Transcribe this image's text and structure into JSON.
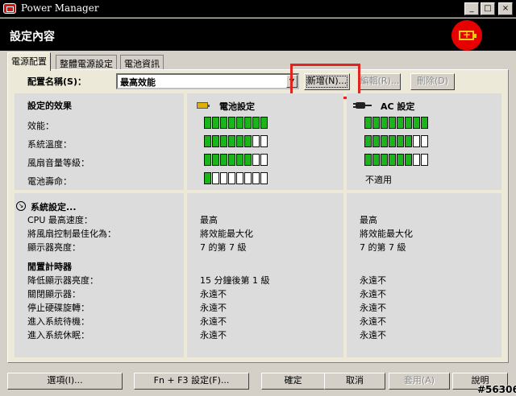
{
  "window": {
    "title": "Power Manager",
    "min": "_",
    "max": "□",
    "close": "×"
  },
  "header": {
    "title": "設定內容"
  },
  "tabs": [
    "電源配置",
    "整體電源設定",
    "電池資訊"
  ],
  "profile": {
    "label": "配置名稱(S)：",
    "selected": "最高效能",
    "new_label": "新增(N)...",
    "edit_label": "編輯(R)...",
    "delete_label": "刪除(D)"
  },
  "effects": {
    "title": "設定的效果",
    "rows": [
      "效能：",
      "系統溫度：",
      "風扇音量等級：",
      "電池壽命："
    ],
    "battery_header": "電池設定",
    "ac_header": "AC 設定",
    "battery_levels": [
      8,
      6,
      6,
      1
    ],
    "ac_levels": [
      8,
      6,
      6,
      null
    ],
    "meter_max": 8,
    "not_applicable": "不適用",
    "on_color": "#1bb51b"
  },
  "system": {
    "title": "系統設定...",
    "rows": [
      {
        "label": "CPU 最高速度：",
        "battery": "最高",
        "ac": "最高"
      },
      {
        "label": "將風扇控制最佳化為：",
        "battery": "將效能最大化",
        "ac": "將效能最大化"
      },
      {
        "label": "顯示器亮度：",
        "battery": "7 的第 7 級",
        "ac": "7 的第 7 級"
      }
    ]
  },
  "timers": {
    "title": "閒置計時器",
    "rows": [
      {
        "label": "降低顯示器亮度：",
        "battery": "15 分鐘後第 1 級",
        "ac": "永遠不"
      },
      {
        "label": "關閉顯示器：",
        "battery": "永遠不",
        "ac": "永遠不"
      },
      {
        "label": "停止硬碟旋轉：",
        "battery": "永遠不",
        "ac": "永遠不"
      },
      {
        "label": "進入系統待機：",
        "battery": "永遠不",
        "ac": "永遠不"
      },
      {
        "label": "進入系統休眠：",
        "battery": "永遠不",
        "ac": "永遠不"
      }
    ]
  },
  "footer": {
    "options": "選項(I)...",
    "fn_f3": "Fn + F3 設定(F)...",
    "ok": "確定",
    "cancel": "取消",
    "apply": "套用(A)",
    "help": "說明"
  },
  "watermark": "#56306"
}
